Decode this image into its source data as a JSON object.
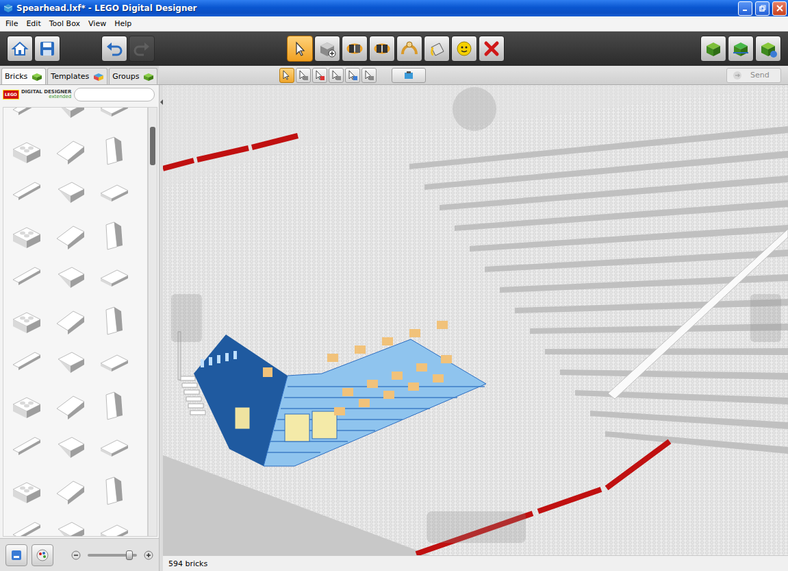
{
  "window": {
    "title": "Spearhead.lxf* - LEGO Digital Designer"
  },
  "menu": [
    "File",
    "Edit",
    "Tool Box",
    "View",
    "Help"
  ],
  "left_tools": [
    {
      "kind": "home",
      "disabled": false
    },
    {
      "kind": "save",
      "disabled": false
    },
    {
      "kind": "undo",
      "disabled": false
    },
    {
      "kind": "redo",
      "disabled": true
    }
  ],
  "tools": [
    {
      "kind": "select",
      "selected": true
    },
    {
      "kind": "clone",
      "selected": false
    },
    {
      "kind": "hinge",
      "selected": false
    },
    {
      "kind": "hinge-align",
      "selected": false
    },
    {
      "kind": "flex",
      "selected": false
    },
    {
      "kind": "paint",
      "selected": false
    },
    {
      "kind": "hide",
      "selected": false
    },
    {
      "kind": "delete",
      "selected": false
    }
  ],
  "mode_buttons": [
    {
      "kind": "build"
    },
    {
      "kind": "view"
    },
    {
      "kind": "instructions"
    }
  ],
  "subtools": [
    {
      "kind": "single",
      "selected": true
    },
    {
      "kind": "add",
      "selected": false
    },
    {
      "kind": "remove",
      "selected": false
    },
    {
      "kind": "connected",
      "selected": false
    },
    {
      "kind": "color",
      "selected": false
    },
    {
      "kind": "shape",
      "selected": false
    }
  ],
  "align_button": {
    "kind": "camera"
  },
  "tabs": [
    {
      "label": "Bricks",
      "selected": true
    },
    {
      "label": "Templates",
      "selected": false
    },
    {
      "label": "Groups",
      "selected": false
    }
  ],
  "logo": {
    "brand": "LEGO",
    "line1": "DIGITAL DESIGNER",
    "line2": "extended"
  },
  "search": {
    "value": ""
  },
  "send": {
    "label": "Send",
    "disabled": true
  },
  "zoom": {
    "level": 0.85
  },
  "status_bar": {
    "text": "594 bricks"
  }
}
